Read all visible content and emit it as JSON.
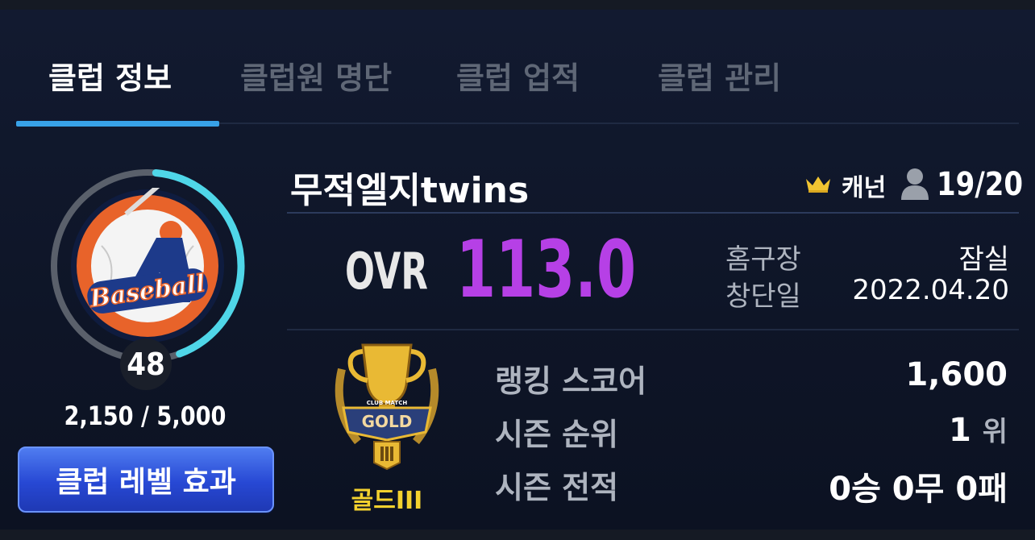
{
  "tabs": [
    {
      "label": "클럽 정보",
      "active": true
    },
    {
      "label": "클럽원 명단",
      "active": false
    },
    {
      "label": "클럽 업적",
      "active": false
    },
    {
      "label": "클럽 관리",
      "active": false
    }
  ],
  "level": {
    "value": "48",
    "exp_text": "2,150 / 5,000",
    "progress_fraction": 0.43,
    "emblem_text": "Baseball",
    "button_label": "클럽 레벨 효과"
  },
  "club": {
    "name": "무적엘지twins",
    "captain_label": "캐넌",
    "members": "19/20",
    "ovr_label": "OVR",
    "ovr_value": "113.0",
    "home_label": "홈구장",
    "home_value": "잠실",
    "founded_label": "창단일",
    "founded_value": "2022.04.20"
  },
  "tier": {
    "label": "골드III",
    "badge_title": "GOLD",
    "badge_subtitle": "CLUB MATCH"
  },
  "stats": {
    "ranking_label": "랭킹 스코어",
    "ranking_value": "1,600",
    "season_rank_label": "시즌 순위",
    "season_rank_value": "1",
    "season_rank_unit": "위",
    "season_record_label": "시즌 전적",
    "season_record_value": "0승 0무 0패"
  },
  "colors": {
    "accent_blue": "#38a2e8",
    "ovr_purple": "#b640e6",
    "tier_gold": "#f3d12e",
    "ring_progress": "#4fd6e8"
  }
}
